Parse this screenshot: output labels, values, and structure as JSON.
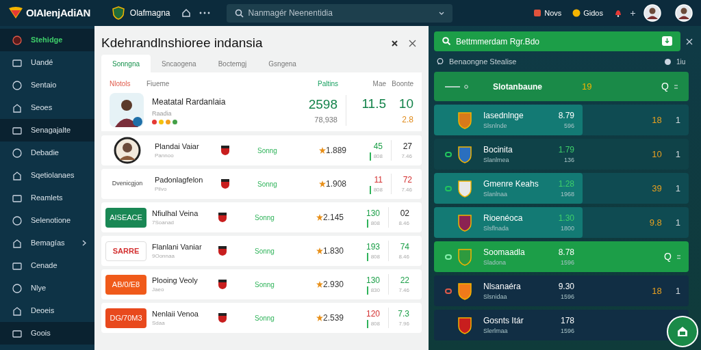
{
  "topbar": {
    "logo_text": "OIAIenjAdiAN",
    "brand": "Olafmagna",
    "search_placeholder": "Nanmagér Neenentidia",
    "links": [
      "Novs",
      "Gidos"
    ]
  },
  "sidebar": {
    "items": [
      {
        "label": "Stehidge",
        "selected": true,
        "highlighted": true,
        "expandable": false
      },
      {
        "label": "Uandé",
        "selected": false,
        "highlighted": false,
        "expandable": false
      },
      {
        "label": "Sentaio",
        "selected": false,
        "highlighted": false,
        "expandable": false
      },
      {
        "label": "Seoes",
        "selected": false,
        "highlighted": false,
        "expandable": false
      },
      {
        "label": "Senagajalte",
        "selected": false,
        "highlighted": true,
        "expandable": false
      },
      {
        "label": "Debadie",
        "selected": false,
        "highlighted": false,
        "expandable": false
      },
      {
        "label": "Sqetiolanaes",
        "selected": false,
        "highlighted": false,
        "expandable": false
      },
      {
        "label": "Reamlets",
        "selected": false,
        "highlighted": false,
        "expandable": false
      },
      {
        "label": "Selenotione",
        "selected": false,
        "highlighted": false,
        "expandable": false
      },
      {
        "label": "Bemagías",
        "selected": false,
        "highlighted": false,
        "expandable": true
      },
      {
        "label": "Cenade",
        "selected": false,
        "highlighted": false,
        "expandable": false
      },
      {
        "label": "Nlye",
        "selected": false,
        "highlighted": false,
        "expandable": false
      },
      {
        "label": "Deoeis",
        "selected": false,
        "highlighted": false,
        "expandable": false
      },
      {
        "label": "Goois",
        "selected": false,
        "highlighted": true,
        "expandable": false
      }
    ]
  },
  "main_panel": {
    "title": "Kdehrandlnshioree indansia",
    "tabs": [
      {
        "label": "Sonngna",
        "selected": true
      },
      {
        "label": "Sncaogena",
        "selected": false
      },
      {
        "label": "Boctemgj",
        "selected": false
      },
      {
        "label": "Gsngena",
        "selected": false
      }
    ],
    "columns": [
      "Nlotols",
      "Fiueme",
      "Paltins",
      "Mae",
      "Boonte"
    ],
    "featured": {
      "name": "Meatatal Rardanlaia",
      "subtitle": "Raadia",
      "dots": [
        {
          "color": "#e53935"
        },
        {
          "color": "#f4c20d"
        },
        {
          "color": "#f4a020"
        },
        {
          "color": "#43a047"
        }
      ],
      "points": "2598",
      "points_sub": "78,938",
      "col_a": "11.5",
      "col_b": "10",
      "col_b_sub": "2.8"
    },
    "rows": [
      {
        "kind": "photo",
        "name": "Plandai Vaiar",
        "subtitle": "Pannoo",
        "status": "Sonng",
        "rating": "1.889",
        "value": {
          "text": "45",
          "color": "#1a9e46"
        },
        "value_sub": "808",
        "score": {
          "text": "27",
          "color": "#222222"
        },
        "score_sub": "7.46"
      },
      {
        "kind": "wordmark",
        "logo_text": "Dvenicgjon",
        "name": "Padonlagfelon",
        "subtitle": "Pilvo",
        "status": "Sonng",
        "rating": "1.908",
        "value": {
          "text": "11",
          "color": "#d32f2f"
        },
        "value_sub": "808",
        "score": {
          "text": "72",
          "color": "#d32f2f"
        },
        "score_sub": "7.46"
      },
      {
        "kind": "badge",
        "logo_text": "AISEACE",
        "color": "#198754",
        "name": "Nfiulhal Veina",
        "subtitle": "7Soanad",
        "status": "Sonng",
        "rating": "2.145",
        "value": {
          "text": "130",
          "color": "#1a9e46"
        },
        "value_sub": "808",
        "score": {
          "text": "02",
          "color": "#222222"
        },
        "score_sub": "8.46"
      },
      {
        "kind": "badge",
        "logo_text": "SARRE",
        "color": "#ffffff",
        "name": "Flanlani Vaniar",
        "subtitle": "9Oonnaa",
        "status": "Sonng",
        "rating": "1.830",
        "value": {
          "text": "193",
          "color": "#1a9e46"
        },
        "value_sub": "808",
        "score": {
          "text": "74",
          "color": "#1a9e46"
        },
        "score_sub": "8.46"
      },
      {
        "kind": "badge",
        "logo_text": "AB/0/E8",
        "color": "#f05a1a",
        "name": "Plooing Veoly",
        "subtitle": "Jaeo",
        "status": "Sonng",
        "rating": "2.930",
        "value": {
          "text": "130",
          "color": "#1a9e46"
        },
        "value_sub": "830",
        "score": {
          "text": "22",
          "color": "#1a9e46"
        },
        "score_sub": "7.46"
      },
      {
        "kind": "badge",
        "logo_text": "DG/70M3",
        "color": "#e8491d",
        "name": "Nenlaii Venoa",
        "subtitle": "Sdaa",
        "status": "Sonng",
        "rating": "2.539",
        "value": {
          "text": "120",
          "color": "#d32f2f"
        },
        "value_sub": "808",
        "score": {
          "text": "7.3",
          "color": "#1a9e46"
        },
        "score_sub": "7.96"
      }
    ]
  },
  "side_panel": {
    "search_value": "Bettmmerdam Rgr.Bdo",
    "subtitle": "Benaongne Stealise",
    "subtitle_right": "1iu",
    "rows": [
      {
        "kind": "header",
        "name": "Slotanbaune",
        "score": "19",
        "mark": "Q"
      },
      {
        "kind": "card",
        "name": "Iasednlnge",
        "subtitle": "Slsnlnde",
        "value": "8.79",
        "value_sub": "596",
        "score": "18",
        "rank": "1"
      },
      {
        "kind": "plain",
        "color": "#22c55e",
        "name": "Bocinita",
        "subtitle": "Slanlmea",
        "value": "1.79",
        "value_sub": "136",
        "score": "10",
        "rank": "1"
      },
      {
        "kind": "card",
        "color": "#22c55e",
        "name": "Gmenre Keahs",
        "subtitle": "Slanlnaa",
        "value": "1.28",
        "value_sub": "1968",
        "score": "39",
        "rank": "1"
      },
      {
        "kind": "card",
        "name": "Rioenéoca",
        "subtitle": "Slsflnada",
        "value": "1.30",
        "value_sub": "1800",
        "score": "9.8",
        "rank": "1"
      },
      {
        "kind": "highlight",
        "color": "#86efac",
        "name": "Soomaadla",
        "subtitle": "Sladona",
        "value": "8.78",
        "value_sub": "1596",
        "mark": "Q"
      },
      {
        "kind": "dark",
        "color": "#e05a4a",
        "name": "Nlsanaéra",
        "subtitle": "Slsnidaa",
        "value": "9.30",
        "value_sub": "1596",
        "score": "18",
        "rank": "1"
      },
      {
        "kind": "dark",
        "name": "Gosnts Itár",
        "subtitle": "Slerlmaa",
        "value": "178",
        "value_sub": "1596"
      }
    ]
  }
}
